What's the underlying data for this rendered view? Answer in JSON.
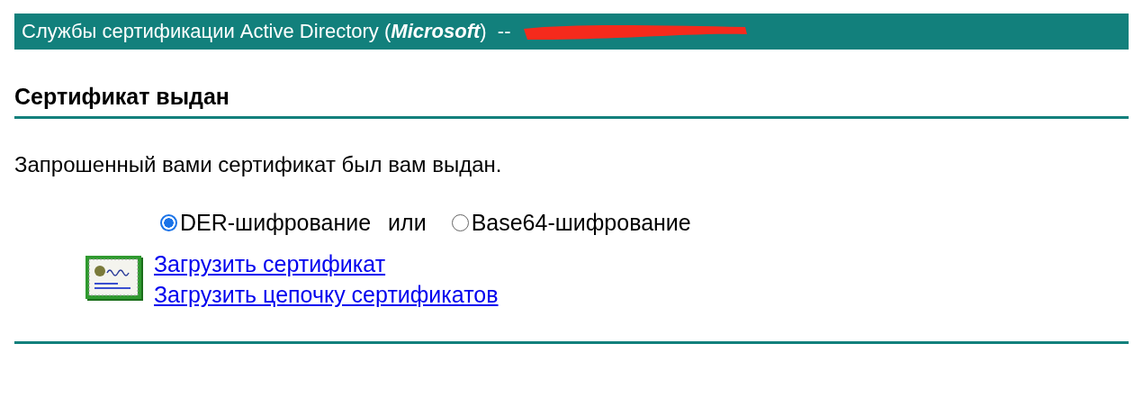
{
  "header": {
    "title": "Службы сертификации Active Directory (**Microsoft**)  --"
  },
  "heading": "Сертификат выдан",
  "message": "Запрошенный вами сертификат был вам выдан.",
  "encoding": {
    "options": [
      {
        "label": "DER-шифрование",
        "selected": true
      },
      {
        "label": "Base64-шифрование",
        "selected": false
      }
    ],
    "separator": "или"
  },
  "links": [
    "Загрузить сертификат",
    "Загрузить цепочку сертификатов"
  ]
}
